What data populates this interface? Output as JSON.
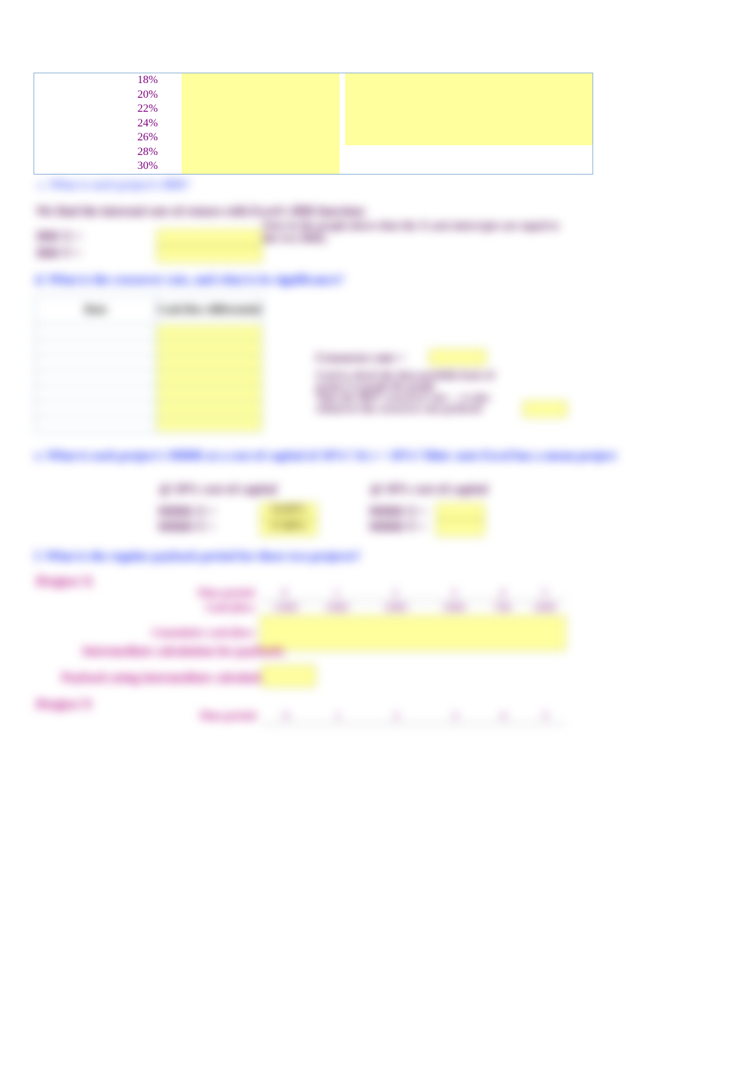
{
  "top_rate_table": {
    "rows": [
      "18%",
      "20%",
      "22%",
      "24%",
      "26%",
      "28%",
      "30%"
    ]
  },
  "q_c": "c.    What is each project's IRR?",
  "c_text": "We find the internal rate of return with Excel's IRR function:",
  "irr_x_label": "IRR X  =",
  "irr_y_label": "IRR Y  =",
  "c_note": "Note in the graph above that the X-axis intercepts are equal to the two IRRs.",
  "q_d": "d.    What is the crossover rate, and what is its significance?",
  "d_table": {
    "hdr_rate": "Rate",
    "hdr_diff": "Cash flow differential",
    "rate_rows": [
      "",
      "",
      "",
      "",
      "",
      "",
      ""
    ]
  },
  "crossover_label": "Crossover rate  =",
  "d_expl_1": "Used to check the data portfolio basis of",
  "d_expl_2": "project to graph the graph",
  "d_expl_3": "Thus the MPV crossover rate — is also",
  "d_expl_4": "whenever the crossover rate prefered",
  "q_e": "e.    What is each project's MIRR at a cost of capital of 10%? At r = 18%? Hint: note Excel has a mean project",
  "e_left_head": "@ 10% cost of capital",
  "e_right_head": "@ 18% cost of capital",
  "mirr_x": "MIRR X  =",
  "mirr_y": "MIRR Y  =",
  "mirr_x_val": "14.60%",
  "mirr_y_val": "17.00%",
  "q_f": "f.    What is the regular payback period for these two projects?",
  "project_x": "Project X",
  "project_y": "Project Y",
  "time_period": "Time period:",
  "cash_flow": "Cash flow:",
  "cum_cash_flow": "Cumulative cash flow:",
  "interm_calc": "Intermediate calculation for payback:",
  "payback_using": "Payback using intermediate calculations:",
  "years_hdr": [
    "0",
    "1",
    "2",
    "3",
    "4",
    "5"
  ],
  "years_vals": [
    "-1000",
    "1000",
    "1000",
    "1000",
    "700",
    "1000"
  ]
}
